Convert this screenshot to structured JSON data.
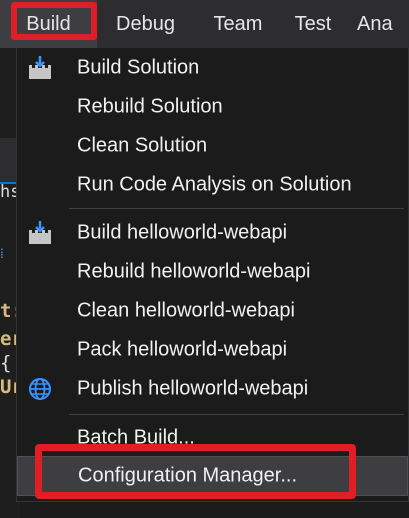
{
  "menubar": {
    "items": [
      {
        "label": "Build"
      },
      {
        "label": "Debug"
      },
      {
        "label": "Team"
      },
      {
        "label": "Test"
      },
      {
        "label": "Ana"
      }
    ]
  },
  "build_menu": {
    "items": [
      {
        "label": "Build Solution",
        "icon": "build-icon"
      },
      {
        "label": "Rebuild Solution"
      },
      {
        "label": "Clean Solution"
      },
      {
        "label": "Run Code Analysis on Solution"
      },
      {
        "label": "Build helloworld-webapi",
        "icon": "build-icon"
      },
      {
        "label": "Rebuild helloworld-webapi"
      },
      {
        "label": "Clean helloworld-webapi"
      },
      {
        "label": "Pack helloworld-webapi"
      },
      {
        "label": "Publish helloworld-webapi",
        "icon": "globe-icon"
      },
      {
        "label": "Batch Build..."
      },
      {
        "label": "Configuration Manager..."
      }
    ]
  },
  "editor_fragments": {
    "line1": "hs",
    "line2": "t:",
    "line3": "er",
    "line4": "{",
    "line5": "Ur"
  },
  "colors": {
    "highlight": "#e01e26",
    "menu_bg": "#1b1b1c",
    "menubar_bg": "#2d2d30",
    "text": "#f1f1f1"
  }
}
